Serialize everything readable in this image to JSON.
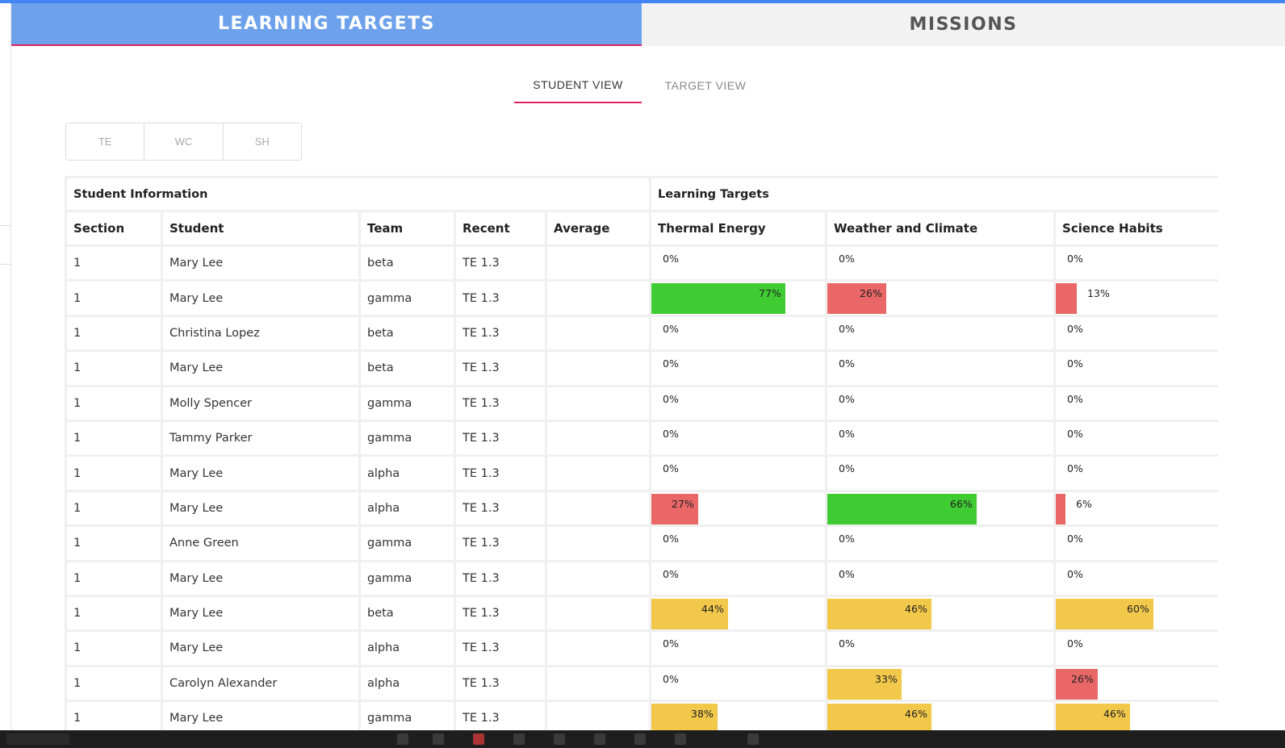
{
  "colors": {
    "green": "#3fcc32",
    "red": "#e96767",
    "yellow": "#f2c84b",
    "accent": "#e0245e",
    "tab_blue": "#6ea1ec"
  },
  "main_tabs": [
    {
      "label": "LEARNING TARGETS",
      "active": true
    },
    {
      "label": "MISSIONS",
      "active": false
    }
  ],
  "sub_tabs": [
    {
      "label": "STUDENT VIEW",
      "active": true
    },
    {
      "label": "TARGET VIEW",
      "active": false
    }
  ],
  "filters": [
    "TE",
    "WC",
    "SH"
  ],
  "table": {
    "group_headers": [
      "Student Information",
      "Learning Targets"
    ],
    "columns": [
      "Section",
      "Student",
      "Team",
      "Recent",
      "Average",
      "Thermal Energy",
      "Weather and Climate",
      "Science Habits"
    ],
    "rows": [
      {
        "section": "1",
        "student": "Mary Lee",
        "team": "beta",
        "recent": "TE 1.3",
        "average": "",
        "thermal": {
          "text": "0%",
          "value": 0,
          "color": "none"
        },
        "weather": {
          "text": "0%",
          "value": 0,
          "color": "none"
        },
        "habits": {
          "text": "0%",
          "value": 0,
          "color": "none"
        }
      },
      {
        "section": "1",
        "student": "Mary Lee",
        "team": "gamma",
        "recent": "TE 1.3",
        "average": "",
        "thermal": {
          "text": "77%",
          "value": 77,
          "color": "green"
        },
        "weather": {
          "text": "26%",
          "value": 26,
          "color": "red"
        },
        "habits": {
          "text": "13%",
          "value": 13,
          "color": "red"
        }
      },
      {
        "section": "1",
        "student": "Christina Lopez",
        "team": "beta",
        "recent": "TE 1.3",
        "average": "",
        "thermal": {
          "text": "0%",
          "value": 0,
          "color": "none"
        },
        "weather": {
          "text": "0%",
          "value": 0,
          "color": "none"
        },
        "habits": {
          "text": "0%",
          "value": 0,
          "color": "none"
        }
      },
      {
        "section": "1",
        "student": "Mary Lee",
        "team": "beta",
        "recent": "TE 1.3",
        "average": "",
        "thermal": {
          "text": "0%",
          "value": 0,
          "color": "none"
        },
        "weather": {
          "text": "0%",
          "value": 0,
          "color": "none"
        },
        "habits": {
          "text": "0%",
          "value": 0,
          "color": "none"
        }
      },
      {
        "section": "1",
        "student": "Molly Spencer",
        "team": "gamma",
        "recent": "TE 1.3",
        "average": "",
        "thermal": {
          "text": "0%",
          "value": 0,
          "color": "none"
        },
        "weather": {
          "text": "0%",
          "value": 0,
          "color": "none"
        },
        "habits": {
          "text": "0%",
          "value": 0,
          "color": "none"
        }
      },
      {
        "section": "1",
        "student": "Tammy Parker",
        "team": "gamma",
        "recent": "TE 1.3",
        "average": "",
        "thermal": {
          "text": "0%",
          "value": 0,
          "color": "none"
        },
        "weather": {
          "text": "0%",
          "value": 0,
          "color": "none"
        },
        "habits": {
          "text": "0%",
          "value": 0,
          "color": "none"
        }
      },
      {
        "section": "1",
        "student": "Mary Lee",
        "team": "alpha",
        "recent": "TE 1.3",
        "average": "",
        "thermal": {
          "text": "0%",
          "value": 0,
          "color": "none"
        },
        "weather": {
          "text": "0%",
          "value": 0,
          "color": "none"
        },
        "habits": {
          "text": "0%",
          "value": 0,
          "color": "none"
        }
      },
      {
        "section": "1",
        "student": "Mary Lee",
        "team": "alpha",
        "recent": "TE 1.3",
        "average": "",
        "thermal": {
          "text": "27%",
          "value": 27,
          "color": "red"
        },
        "weather": {
          "text": "66%",
          "value": 66,
          "color": "green"
        },
        "habits": {
          "text": "6%",
          "value": 6,
          "color": "red"
        }
      },
      {
        "section": "1",
        "student": "Anne Green",
        "team": "gamma",
        "recent": "TE 1.3",
        "average": "",
        "thermal": {
          "text": "0%",
          "value": 0,
          "color": "none"
        },
        "weather": {
          "text": "0%",
          "value": 0,
          "color": "none"
        },
        "habits": {
          "text": "0%",
          "value": 0,
          "color": "none"
        }
      },
      {
        "section": "1",
        "student": "Mary Lee",
        "team": "gamma",
        "recent": "TE 1.3",
        "average": "",
        "thermal": {
          "text": "0%",
          "value": 0,
          "color": "none"
        },
        "weather": {
          "text": "0%",
          "value": 0,
          "color": "none"
        },
        "habits": {
          "text": "0%",
          "value": 0,
          "color": "none"
        }
      },
      {
        "section": "1",
        "student": "Mary Lee",
        "team": "beta",
        "recent": "TE 1.3",
        "average": "",
        "thermal": {
          "text": "44%",
          "value": 44,
          "color": "yellow"
        },
        "weather": {
          "text": "46%",
          "value": 46,
          "color": "yellow"
        },
        "habits": {
          "text": "60%",
          "value": 60,
          "color": "yellow"
        }
      },
      {
        "section": "1",
        "student": "Mary Lee",
        "team": "alpha",
        "recent": "TE 1.3",
        "average": "",
        "thermal": {
          "text": "0%",
          "value": 0,
          "color": "none"
        },
        "weather": {
          "text": "0%",
          "value": 0,
          "color": "none"
        },
        "habits": {
          "text": "0%",
          "value": 0,
          "color": "none"
        }
      },
      {
        "section": "1",
        "student": "Carolyn Alexander",
        "team": "alpha",
        "recent": "TE 1.3",
        "average": "",
        "thermal": {
          "text": "0%",
          "value": 0,
          "color": "none"
        },
        "weather": {
          "text": "33%",
          "value": 33,
          "color": "yellow"
        },
        "habits": {
          "text": "26%",
          "value": 26,
          "color": "red"
        }
      },
      {
        "section": "1",
        "student": "Mary Lee",
        "team": "gamma",
        "recent": "TE 1.3",
        "average": "",
        "thermal": {
          "text": "38%",
          "value": 38,
          "color": "yellow"
        },
        "weather": {
          "text": "46%",
          "value": 46,
          "color": "yellow"
        },
        "habits": {
          "text": "46%",
          "value": 46,
          "color": "yellow"
        }
      }
    ]
  }
}
